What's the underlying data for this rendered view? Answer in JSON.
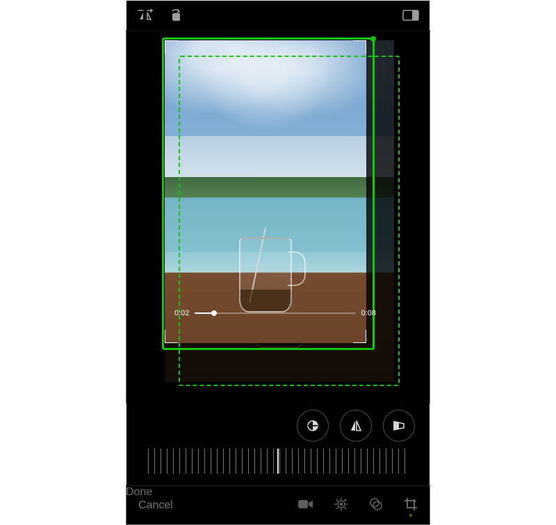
{
  "accent": {
    "green": "#16c40f",
    "dot": "#ffcc00"
  },
  "topbar": {
    "flip_horizontal_label": "Flip Horizontal",
    "rotate_label": "Rotate",
    "aspect_label": "Aspect Ratio"
  },
  "timeline": {
    "current": "0:02",
    "total": "0:08",
    "progress_pct": 12
  },
  "circle_tools": {
    "horizon_label": "Flip Vertical",
    "mirror_label": "Flip Horizontal",
    "perspective_label": "Perspective"
  },
  "dial": {
    "value_deg": 0
  },
  "bottombar": {
    "cancel": "Cancel",
    "done": "Done",
    "tabs": {
      "video": "Video",
      "adjust": "Adjust",
      "filters": "Filters",
      "crop": "Crop"
    },
    "active_tab": "crop"
  }
}
